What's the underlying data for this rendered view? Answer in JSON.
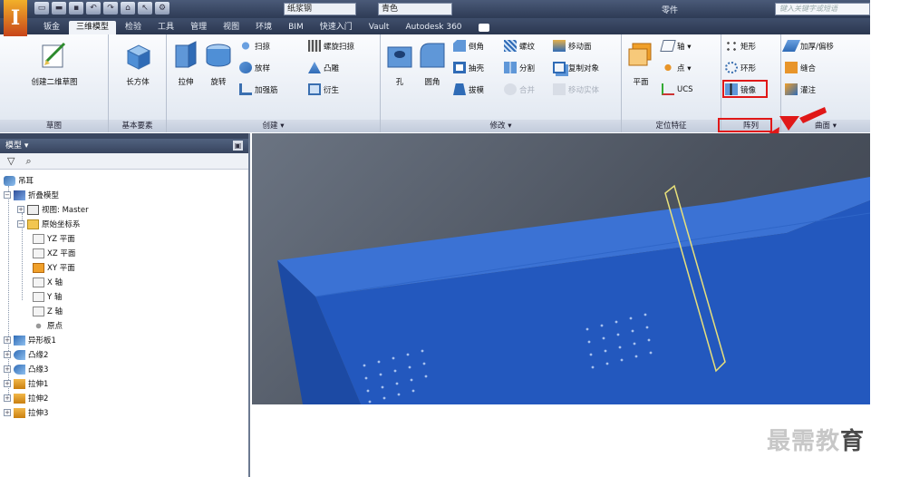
{
  "titlebar": {
    "material": "纸浆钢",
    "appearance": "青色",
    "doc_title": "零件",
    "search_placeholder": "键入关键字或短语"
  },
  "tabs": [
    "钣金",
    "三维模型",
    "检验",
    "工具",
    "管理",
    "视图",
    "环境",
    "BIM",
    "快速入门",
    "Vault",
    "Autodesk 360"
  ],
  "active_tab": "三维模型",
  "ribbon": {
    "sketch_panel": {
      "title": "草图",
      "create_sketch": "创建二维草图"
    },
    "primitive_panel": {
      "title": "基本要素",
      "box": "长方体"
    },
    "create_panel": {
      "title": "创建 ▾",
      "extrude": "拉伸",
      "revolve": "旋转",
      "sweep": "扫掠",
      "loft": "放样",
      "rib": "加强筋",
      "coil": "螺旋扫掠",
      "emboss": "凸雕",
      "derive": "衍生"
    },
    "modify_panel": {
      "title": "修改 ▾",
      "hole": "孔",
      "fillet": "圆角",
      "chamfer": "倒角",
      "shell": "抽壳",
      "draft": "拔模",
      "thread": "螺纹",
      "split": "分割",
      "combine": "合并",
      "move_face": "移动面",
      "copy_object": "复制对象",
      "move_body": "移动实体"
    },
    "workfeature_panel": {
      "title": "定位特征",
      "plane": "平面",
      "axis": "轴 ▾",
      "point": "点 ▾",
      "ucs": "UCS"
    },
    "pattern_panel": {
      "title": "阵列",
      "rectangular": "矩形",
      "circular": "环形",
      "mirror": "镜像"
    },
    "surface_panel": {
      "title": "曲面 ▾",
      "thicken": "加厚/偏移",
      "stitch": "缝合",
      "patch": "灌注"
    }
  },
  "browser": {
    "header": "模型 ▾",
    "tree": [
      {
        "label": "吊耳",
        "level": 0
      },
      {
        "label": "折叠模型",
        "level": 0
      },
      {
        "label": "视图: Master",
        "level": 1
      },
      {
        "label": "原始坐标系",
        "level": 1
      },
      {
        "label": "YZ 平面",
        "level": 2
      },
      {
        "label": "XZ 平面",
        "level": 2
      },
      {
        "label": "XY 平面",
        "level": 2
      },
      {
        "label": "X 轴",
        "level": 2
      },
      {
        "label": "Y 轴",
        "level": 2
      },
      {
        "label": "Z 轴",
        "level": 2
      },
      {
        "label": "原点",
        "level": 2
      },
      {
        "label": "异形板1",
        "level": 1
      },
      {
        "label": "凸缘2",
        "level": 1
      },
      {
        "label": "凸缘3",
        "level": 1
      },
      {
        "label": "拉伸1",
        "level": 1
      },
      {
        "label": "拉伸2",
        "level": 1
      },
      {
        "label": "拉伸3",
        "level": 1
      }
    ]
  },
  "watermark": {
    "text": "最需教",
    "last_char": "育"
  },
  "colors": {
    "accent_red": "#e01818",
    "model_blue": "#2f63c8",
    "sketch_yellow": "#e8e07a"
  }
}
